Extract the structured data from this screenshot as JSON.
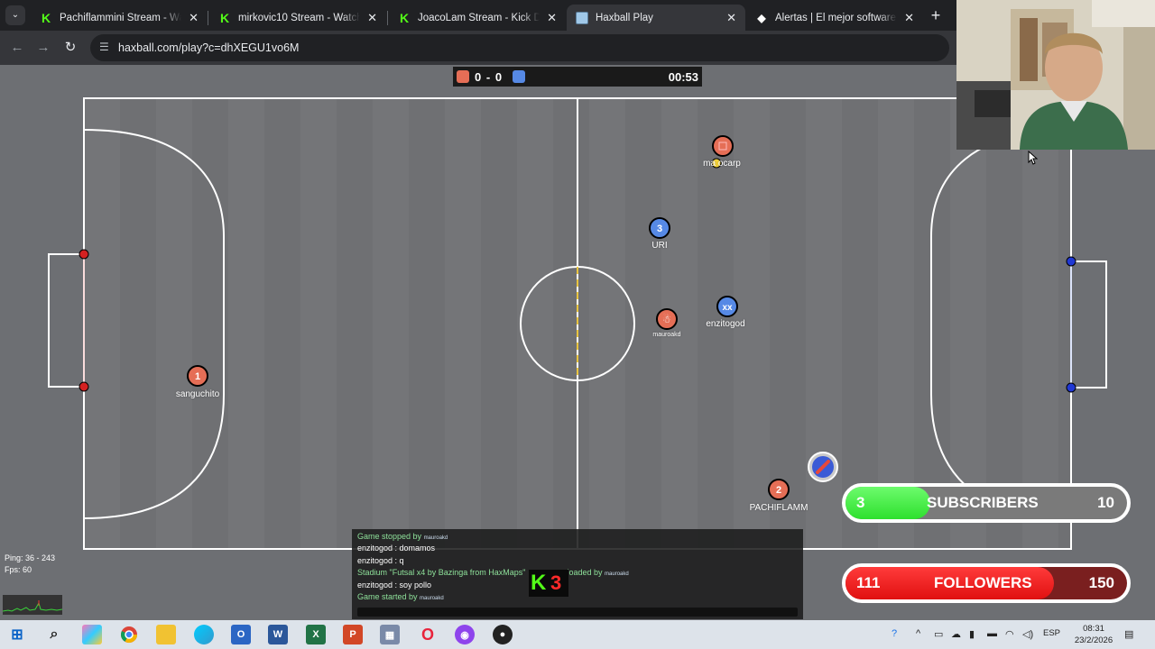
{
  "browser": {
    "tabs": [
      {
        "title": "Pachiflammini Stream - Watch Live",
        "icon": "kick-icon",
        "active": false
      },
      {
        "title": "mirkovic10 Stream - Watch Live",
        "icon": "kick-icon",
        "active": false
      },
      {
        "title": "JoacoLam Stream - Kick Dashboard",
        "icon": "kick-icon",
        "active": false
      },
      {
        "title": "Haxball Play",
        "icon": "haxball-icon",
        "active": true
      },
      {
        "title": "Alertas | El mejor software para streamers",
        "icon": "alert-icon",
        "active": false
      }
    ],
    "url": "haxball.com/play?c=dhXEGU1vo6M"
  },
  "game": {
    "score_red": "0",
    "score_sep": "-",
    "score_blue": "0",
    "timer": "00:53",
    "colors": {
      "red": "#e56e56",
      "blue": "#5689e5",
      "field": "#6d6f73",
      "line": "#ffffff"
    },
    "players": [
      {
        "team": "red",
        "number": "1",
        "name": "sanguchito"
      },
      {
        "team": "red",
        "number": "2",
        "name": "PACHIFLAMM"
      },
      {
        "team": "red",
        "number": "",
        "name": "mauroakd"
      },
      {
        "team": "red",
        "number": "",
        "name": "ma  ocarp"
      },
      {
        "team": "blue",
        "number": "3",
        "name": "URI"
      },
      {
        "team": "blue",
        "number": "xx",
        "name": "enzitogod"
      }
    ]
  },
  "chat": {
    "lines": [
      {
        "text": "Game stopped by",
        "by": "mauroakd",
        "system": true
      },
      {
        "text": "enzitogod : domamos",
        "by": "",
        "system": false
      },
      {
        "text": "enzitogod : q",
        "by": "",
        "system": false
      },
      {
        "text": "Stadium \"Futsal x4 by Bazinga from HaxMaps\"",
        "suffix": "loaded by",
        "by": "mauroakd",
        "system": true
      },
      {
        "text": "enzitogod : soy pollo",
        "by": "",
        "system": false
      },
      {
        "text": "Game started by",
        "by": "mauroakd",
        "system": true
      }
    ]
  },
  "stats": {
    "ping": "Ping: 36 - 243",
    "fps": "Fps: 60"
  },
  "kick_badge": {
    "k": "K",
    "n": "3"
  },
  "goals": {
    "subscribers": {
      "current": "3",
      "label": "SUBSCRIBERS",
      "goal": "10",
      "progress": 0.3
    },
    "followers": {
      "current": "111",
      "label": "FOLLOWERS",
      "goal": "150",
      "progress": 0.74
    }
  },
  "taskbar": {
    "language": "ESP",
    "time": "08:31",
    "date": "23/2/2026"
  }
}
